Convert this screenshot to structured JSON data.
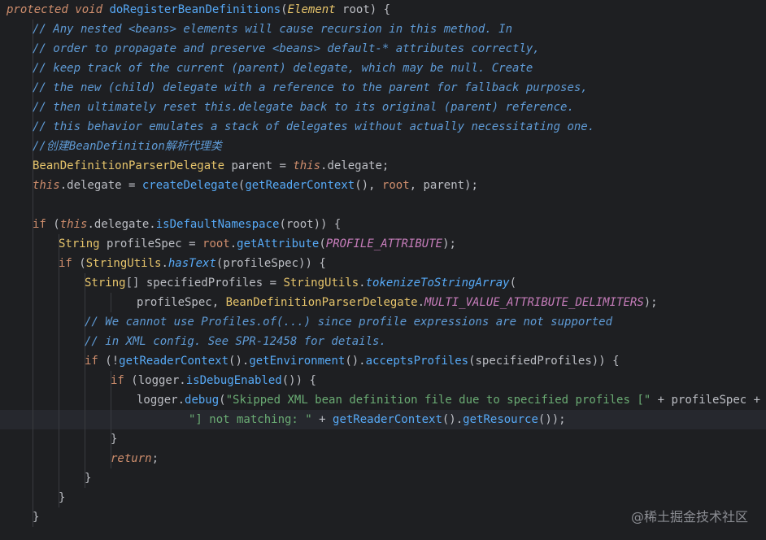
{
  "code_lines": [
    {
      "indent": 0,
      "segments": [
        [
          "kw",
          "protected"
        ],
        [
          "txt",
          " "
        ],
        [
          "kw",
          "void"
        ],
        [
          "txt",
          " "
        ],
        [
          "meth",
          "doRegisterBeanDefinitions"
        ],
        [
          "txt",
          "("
        ],
        [
          "typi",
          "Element"
        ],
        [
          "txt",
          " root) {"
        ]
      ]
    },
    {
      "indent": 1,
      "segments": [
        [
          "cmt",
          "// Any nested <beans> elements will cause recursion in this method. In"
        ]
      ]
    },
    {
      "indent": 1,
      "segments": [
        [
          "cmt",
          "// order to propagate and preserve <beans> default-* attributes correctly,"
        ]
      ]
    },
    {
      "indent": 1,
      "segments": [
        [
          "cmt",
          "// keep track of the current (parent) delegate, which may be null. Create"
        ]
      ]
    },
    {
      "indent": 1,
      "segments": [
        [
          "cmt",
          "// the new (child) delegate with a reference to the parent for fallback purposes,"
        ]
      ]
    },
    {
      "indent": 1,
      "segments": [
        [
          "cmt",
          "// then ultimately reset this.delegate back to its original (parent) reference."
        ]
      ]
    },
    {
      "indent": 1,
      "segments": [
        [
          "cmt",
          "// this behavior emulates a stack of delegates without actually necessitating one."
        ]
      ]
    },
    {
      "indent": 1,
      "segments": [
        [
          "cmt",
          "//创建BeanDefinition解析代理类"
        ]
      ]
    },
    {
      "indent": 1,
      "segments": [
        [
          "type",
          "BeanDefinitionParserDelegate"
        ],
        [
          "txt",
          " parent = "
        ],
        [
          "kw",
          "this"
        ],
        [
          "txt",
          ".delegate;"
        ]
      ]
    },
    {
      "indent": 1,
      "segments": [
        [
          "kw",
          "this"
        ],
        [
          "txt",
          ".delegate = "
        ],
        [
          "call",
          "createDelegate"
        ],
        [
          "txt",
          "("
        ],
        [
          "call",
          "getReaderContext"
        ],
        [
          "txt",
          "(), "
        ],
        [
          "kwn",
          "root"
        ],
        [
          "txt",
          ", parent);"
        ]
      ]
    },
    {
      "indent": 1,
      "segments": []
    },
    {
      "indent": 1,
      "segments": [
        [
          "kwn",
          "if"
        ],
        [
          "txt",
          " ("
        ],
        [
          "kw",
          "this"
        ],
        [
          "txt",
          ".delegate."
        ],
        [
          "call",
          "isDefaultNamespace"
        ],
        [
          "txt",
          "(root)) {"
        ]
      ]
    },
    {
      "indent": 2,
      "segments": [
        [
          "type",
          "String"
        ],
        [
          "txt",
          " profileSpec = "
        ],
        [
          "kwn",
          "root"
        ],
        [
          "txt",
          "."
        ],
        [
          "call",
          "getAttribute"
        ],
        [
          "txt",
          "("
        ],
        [
          "cnst",
          "PROFILE_ATTRIBUTE"
        ],
        [
          "txt",
          ");"
        ]
      ]
    },
    {
      "indent": 2,
      "segments": [
        [
          "kwn",
          "if"
        ],
        [
          "txt",
          " ("
        ],
        [
          "type",
          "StringUtils"
        ],
        [
          "txt",
          "."
        ],
        [
          "stat",
          "hasText"
        ],
        [
          "txt",
          "(profileSpec)) {"
        ]
      ]
    },
    {
      "indent": 3,
      "segments": [
        [
          "type",
          "String"
        ],
        [
          "txt",
          "[] specifiedProfiles = "
        ],
        [
          "type",
          "StringUtils"
        ],
        [
          "txt",
          "."
        ],
        [
          "stat",
          "tokenizeToStringArray"
        ],
        [
          "txt",
          "("
        ]
      ]
    },
    {
      "indent": 5,
      "segments": [
        [
          "txt",
          "profileSpec, "
        ],
        [
          "type",
          "BeanDefinitionParserDelegate"
        ],
        [
          "txt",
          "."
        ],
        [
          "cnst",
          "MULTI_VALUE_ATTRIBUTE_DELIMITERS"
        ],
        [
          "txt",
          ");"
        ]
      ]
    },
    {
      "indent": 3,
      "segments": [
        [
          "cmt",
          "// We cannot use Profiles.of(...) since profile expressions are not supported"
        ]
      ]
    },
    {
      "indent": 3,
      "segments": [
        [
          "cmt",
          "// in XML config. See SPR-12458 for details."
        ]
      ]
    },
    {
      "indent": 3,
      "segments": [
        [
          "kwn",
          "if"
        ],
        [
          "txt",
          " (!"
        ],
        [
          "call",
          "getReaderContext"
        ],
        [
          "txt",
          "()."
        ],
        [
          "call",
          "getEnvironment"
        ],
        [
          "txt",
          "()."
        ],
        [
          "call",
          "acceptsProfiles"
        ],
        [
          "txt",
          "(specifiedProfiles)) {"
        ]
      ]
    },
    {
      "indent": 4,
      "segments": [
        [
          "kwn",
          "if"
        ],
        [
          "txt",
          " (logger."
        ],
        [
          "call",
          "isDebugEnabled"
        ],
        [
          "txt",
          "()) {"
        ]
      ]
    },
    {
      "indent": 5,
      "segments": [
        [
          "txt",
          "logger."
        ],
        [
          "call",
          "debug"
        ],
        [
          "txt",
          "("
        ],
        [
          "str",
          "\"Skipped XML bean definition file due to specified profiles [\""
        ],
        [
          "txt",
          " + profileSpec +"
        ]
      ]
    },
    {
      "indent": 7,
      "segments": [
        [
          "str",
          "\"] not matching: \""
        ],
        [
          "txt",
          " + "
        ],
        [
          "call",
          "getReaderContext"
        ],
        [
          "txt",
          "()."
        ],
        [
          "call",
          "getResource"
        ],
        [
          "txt",
          "());"
        ]
      ]
    },
    {
      "indent": 4,
      "segments": [
        [
          "txt",
          "}"
        ]
      ]
    },
    {
      "indent": 4,
      "segments": [
        [
          "kw",
          "return"
        ],
        [
          "txt",
          ";"
        ]
      ]
    },
    {
      "indent": 3,
      "segments": [
        [
          "txt",
          "}"
        ]
      ]
    },
    {
      "indent": 2,
      "segments": [
        [
          "txt",
          "}"
        ]
      ]
    },
    {
      "indent": 1,
      "segments": [
        [
          "txt",
          "}"
        ]
      ]
    }
  ],
  "highlighted_line": 21,
  "watermark": "@稀土掘金技术社区"
}
